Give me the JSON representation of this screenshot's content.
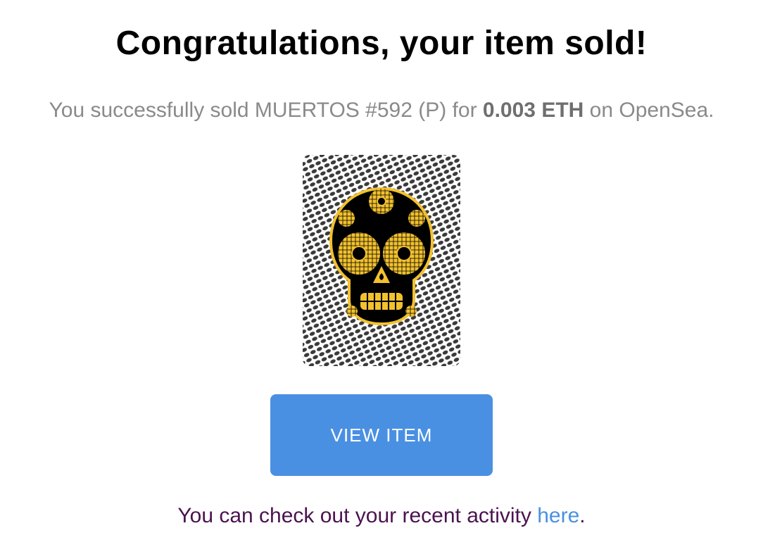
{
  "heading": "Congratulations, your item sold!",
  "sale": {
    "prefix": "You successfully sold MUERTOS #592 (P) for ",
    "price": "0.003 ETH",
    "suffix": " on OpenSea."
  },
  "nft_image": {
    "alt": "MUERTOS #592 (P)",
    "icon": "sugar-skull-icon",
    "colors": {
      "skull": "#000000",
      "gold": "#f2c12e",
      "background": "#d9d9d9"
    }
  },
  "view_button": {
    "label": "VIEW ITEM",
    "color": "#4a90e2"
  },
  "footer": {
    "prefix": "You can check out your recent activity ",
    "link_label": "here",
    "suffix": "."
  }
}
